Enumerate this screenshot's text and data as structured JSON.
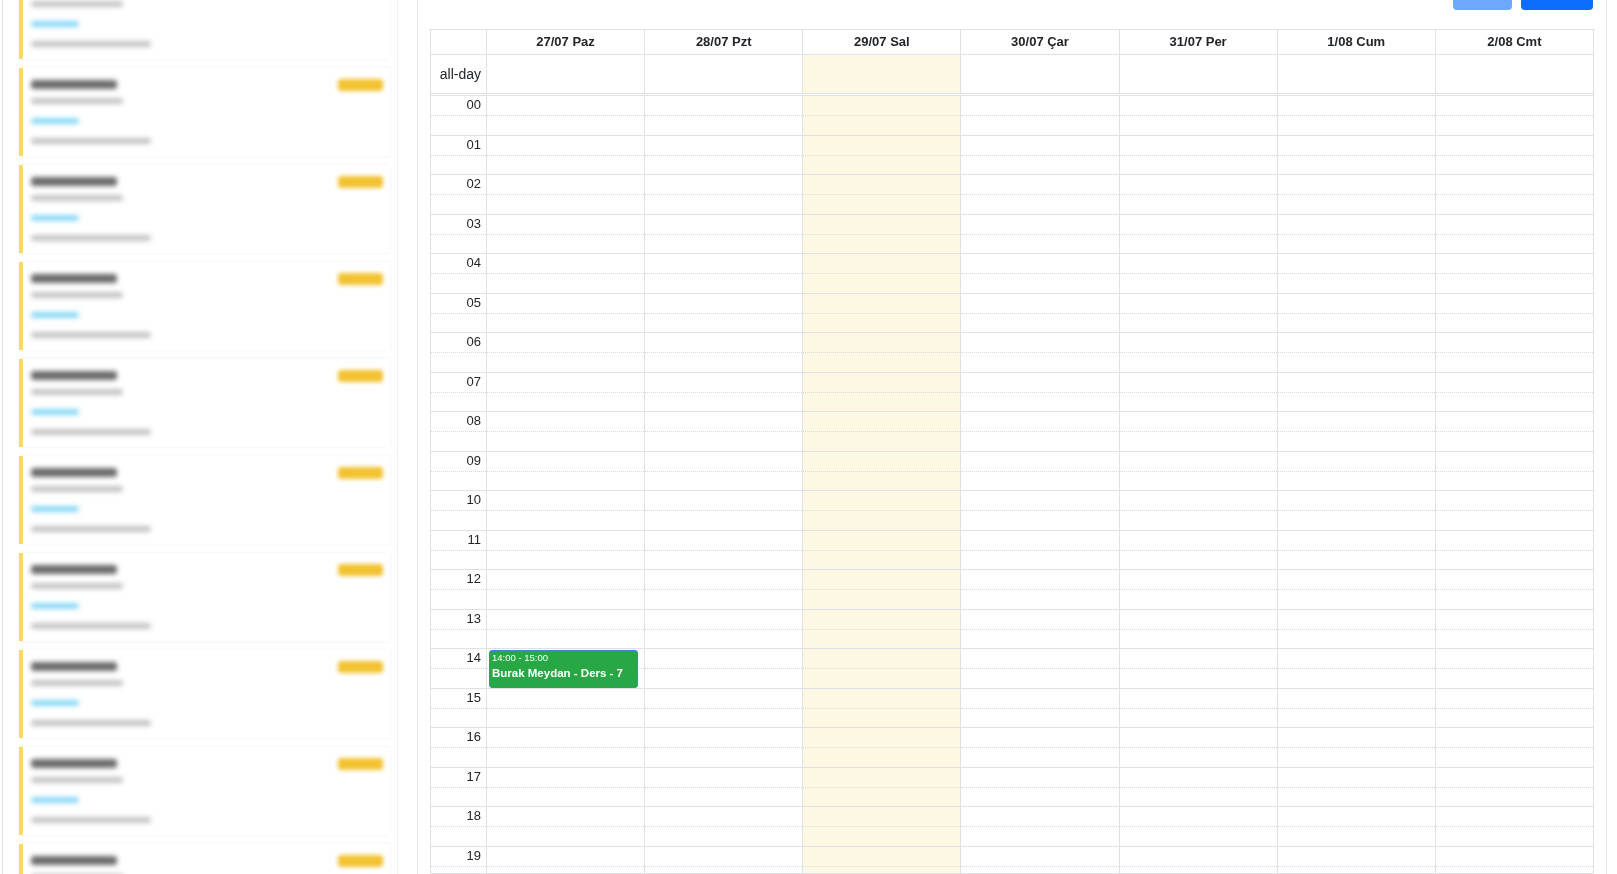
{
  "sidebar": {
    "cards": [
      {
        "blurred": true
      },
      {
        "blurred": true
      },
      {
        "blurred": true
      },
      {
        "blurred": true
      },
      {
        "blurred": true
      },
      {
        "blurred": true
      },
      {
        "blurred": true
      },
      {
        "blurred": true
      },
      {
        "blurred": true
      },
      {
        "blurred": true
      }
    ]
  },
  "toolbar": {
    "buttons": [
      {
        "kind": "secondary"
      },
      {
        "kind": "primary"
      }
    ]
  },
  "calendar": {
    "all_day_label": "all-day",
    "days": [
      {
        "label": "27/07 Paz",
        "today": false,
        "events": [
          {
            "time": "14:00 - 15:00",
            "title": "Burak Meydan - Ders - 7"
          }
        ]
      },
      {
        "label": "28/07 Pzt",
        "today": false
      },
      {
        "label": "29/07 Sal",
        "today": true
      },
      {
        "label": "30/07 Çar",
        "today": false
      },
      {
        "label": "31/07 Per",
        "today": false
      },
      {
        "label": "1/08 Cum",
        "today": false
      },
      {
        "label": "2/08 Cmt",
        "today": false
      }
    ],
    "hours": [
      "00",
      "01",
      "02",
      "03",
      "04",
      "05",
      "06",
      "07",
      "08",
      "09",
      "10",
      "11",
      "12",
      "13",
      "14",
      "15",
      "16",
      "17",
      "18",
      "19"
    ]
  }
}
